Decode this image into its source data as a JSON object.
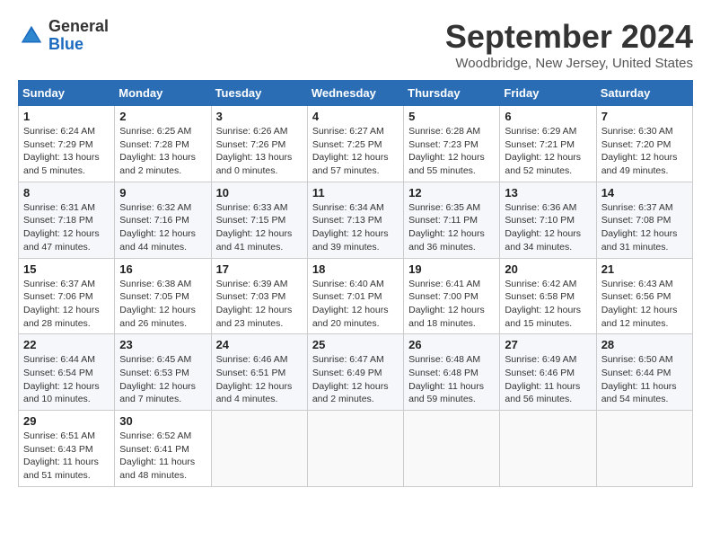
{
  "logo": {
    "general": "General",
    "blue": "Blue"
  },
  "title": "September 2024",
  "location": "Woodbridge, New Jersey, United States",
  "days_of_week": [
    "Sunday",
    "Monday",
    "Tuesday",
    "Wednesday",
    "Thursday",
    "Friday",
    "Saturday"
  ],
  "weeks": [
    [
      {
        "day": "1",
        "info": "Sunrise: 6:24 AM\nSunset: 7:29 PM\nDaylight: 13 hours\nand 5 minutes."
      },
      {
        "day": "2",
        "info": "Sunrise: 6:25 AM\nSunset: 7:28 PM\nDaylight: 13 hours\nand 2 minutes."
      },
      {
        "day": "3",
        "info": "Sunrise: 6:26 AM\nSunset: 7:26 PM\nDaylight: 13 hours\nand 0 minutes."
      },
      {
        "day": "4",
        "info": "Sunrise: 6:27 AM\nSunset: 7:25 PM\nDaylight: 12 hours\nand 57 minutes."
      },
      {
        "day": "5",
        "info": "Sunrise: 6:28 AM\nSunset: 7:23 PM\nDaylight: 12 hours\nand 55 minutes."
      },
      {
        "day": "6",
        "info": "Sunrise: 6:29 AM\nSunset: 7:21 PM\nDaylight: 12 hours\nand 52 minutes."
      },
      {
        "day": "7",
        "info": "Sunrise: 6:30 AM\nSunset: 7:20 PM\nDaylight: 12 hours\nand 49 minutes."
      }
    ],
    [
      {
        "day": "8",
        "info": "Sunrise: 6:31 AM\nSunset: 7:18 PM\nDaylight: 12 hours\nand 47 minutes."
      },
      {
        "day": "9",
        "info": "Sunrise: 6:32 AM\nSunset: 7:16 PM\nDaylight: 12 hours\nand 44 minutes."
      },
      {
        "day": "10",
        "info": "Sunrise: 6:33 AM\nSunset: 7:15 PM\nDaylight: 12 hours\nand 41 minutes."
      },
      {
        "day": "11",
        "info": "Sunrise: 6:34 AM\nSunset: 7:13 PM\nDaylight: 12 hours\nand 39 minutes."
      },
      {
        "day": "12",
        "info": "Sunrise: 6:35 AM\nSunset: 7:11 PM\nDaylight: 12 hours\nand 36 minutes."
      },
      {
        "day": "13",
        "info": "Sunrise: 6:36 AM\nSunset: 7:10 PM\nDaylight: 12 hours\nand 34 minutes."
      },
      {
        "day": "14",
        "info": "Sunrise: 6:37 AM\nSunset: 7:08 PM\nDaylight: 12 hours\nand 31 minutes."
      }
    ],
    [
      {
        "day": "15",
        "info": "Sunrise: 6:37 AM\nSunset: 7:06 PM\nDaylight: 12 hours\nand 28 minutes."
      },
      {
        "day": "16",
        "info": "Sunrise: 6:38 AM\nSunset: 7:05 PM\nDaylight: 12 hours\nand 26 minutes."
      },
      {
        "day": "17",
        "info": "Sunrise: 6:39 AM\nSunset: 7:03 PM\nDaylight: 12 hours\nand 23 minutes."
      },
      {
        "day": "18",
        "info": "Sunrise: 6:40 AM\nSunset: 7:01 PM\nDaylight: 12 hours\nand 20 minutes."
      },
      {
        "day": "19",
        "info": "Sunrise: 6:41 AM\nSunset: 7:00 PM\nDaylight: 12 hours\nand 18 minutes."
      },
      {
        "day": "20",
        "info": "Sunrise: 6:42 AM\nSunset: 6:58 PM\nDaylight: 12 hours\nand 15 minutes."
      },
      {
        "day": "21",
        "info": "Sunrise: 6:43 AM\nSunset: 6:56 PM\nDaylight: 12 hours\nand 12 minutes."
      }
    ],
    [
      {
        "day": "22",
        "info": "Sunrise: 6:44 AM\nSunset: 6:54 PM\nDaylight: 12 hours\nand 10 minutes."
      },
      {
        "day": "23",
        "info": "Sunrise: 6:45 AM\nSunset: 6:53 PM\nDaylight: 12 hours\nand 7 minutes."
      },
      {
        "day": "24",
        "info": "Sunrise: 6:46 AM\nSunset: 6:51 PM\nDaylight: 12 hours\nand 4 minutes."
      },
      {
        "day": "25",
        "info": "Sunrise: 6:47 AM\nSunset: 6:49 PM\nDaylight: 12 hours\nand 2 minutes."
      },
      {
        "day": "26",
        "info": "Sunrise: 6:48 AM\nSunset: 6:48 PM\nDaylight: 11 hours\nand 59 minutes."
      },
      {
        "day": "27",
        "info": "Sunrise: 6:49 AM\nSunset: 6:46 PM\nDaylight: 11 hours\nand 56 minutes."
      },
      {
        "day": "28",
        "info": "Sunrise: 6:50 AM\nSunset: 6:44 PM\nDaylight: 11 hours\nand 54 minutes."
      }
    ],
    [
      {
        "day": "29",
        "info": "Sunrise: 6:51 AM\nSunset: 6:43 PM\nDaylight: 11 hours\nand 51 minutes."
      },
      {
        "day": "30",
        "info": "Sunrise: 6:52 AM\nSunset: 6:41 PM\nDaylight: 11 hours\nand 48 minutes."
      },
      null,
      null,
      null,
      null,
      null
    ]
  ]
}
